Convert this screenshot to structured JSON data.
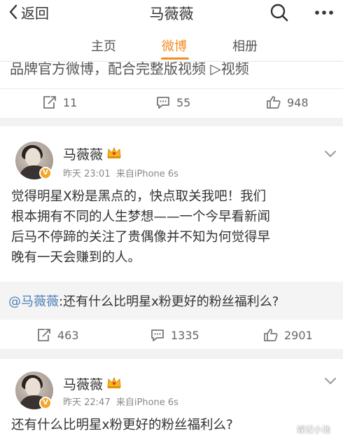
{
  "header": {
    "back_label": "返回",
    "title": "马薇薇"
  },
  "tabs": [
    {
      "label": "主页",
      "active": false
    },
    {
      "label": "微博",
      "active": true
    },
    {
      "label": "相册",
      "active": false
    }
  ],
  "posts": [
    {
      "text_partial": "品牌官方微博，配合完整版视频 ▷视频",
      "repost_count": "11",
      "comment_count": "55",
      "like_count": "948"
    },
    {
      "username": "马薇薇",
      "time": "昨天 23:01",
      "source": "来自iPhone 6s",
      "text": "觉得明星X粉是黑点的，快点取关我吧！我们根本拥有不同的人生梦想——一个今早看新闻后马不停蹄的关注了贵偶像并不知为何觉得早晚有一天会赚到的人。",
      "lines": [
        "觉得明星X粉是黑点的，快点取关我吧！我们",
        "根本拥有不同的人生梦想——一个今早看新闻",
        "后马不停蹄的关注了贵偶像并不知为何觉得早",
        "晚有一天会赚到的人。"
      ],
      "quote_mention": "@马薇薇",
      "quote_text": ":还有什么比明星x粉更好的粉丝福利么?",
      "repost_count": "463",
      "comment_count": "1335",
      "like_count": "2901"
    },
    {
      "username": "马薇薇",
      "time": "昨天 22:47",
      "source": "来自iPhone 6s",
      "text": "还有什么比明星x粉更好的粉丝福利么?"
    }
  ],
  "watermark": "娱记小池",
  "icons": {
    "back": "chevron-left-icon",
    "search": "search-icon",
    "more": "more-dots-icon",
    "repost": "repost-icon",
    "comment": "comment-icon",
    "like": "thumbs-up-icon",
    "verified": "verified-v-badge",
    "vip": "crown-icon",
    "expand": "chevron-down-icon"
  },
  "colors": {
    "accent": "#f48b25",
    "link": "#4e7fb8",
    "badge": "#f5a623",
    "background": "#f2f2f2"
  }
}
